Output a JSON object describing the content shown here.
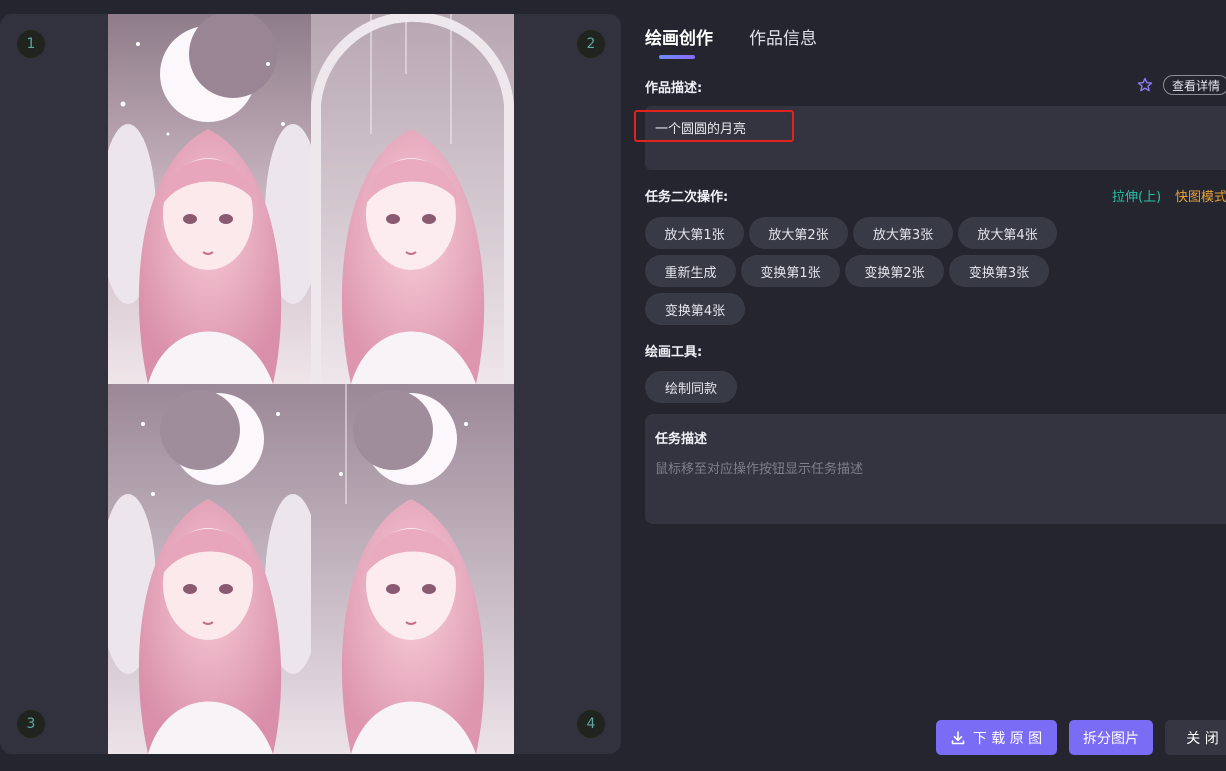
{
  "preview": {
    "quadrant_numbers": [
      "1",
      "2",
      "3",
      "4"
    ]
  },
  "tabs": [
    {
      "label": "绘画创作",
      "active": true
    },
    {
      "label": "作品信息",
      "active": false
    }
  ],
  "description": {
    "label": "作品描述:",
    "value": "一个圆圆的月亮",
    "detail_button": "查看详情",
    "star_icon": "star-outline-icon"
  },
  "secondary_ops": {
    "label": "任务二次操作:",
    "stretch_link": "拉伸(上)",
    "fast_mode_link": "快图模式",
    "buttons": [
      "放大第1张",
      "放大第2张",
      "放大第3张",
      "放大第4张",
      "重新生成",
      "变换第1张",
      "变换第2张",
      "变换第3张",
      "变换第4张"
    ]
  },
  "tools": {
    "label": "绘画工具:",
    "buttons": [
      "绘制同款"
    ]
  },
  "task": {
    "title": "任务描述",
    "hint": "鼠标移至对应操作按钮显示任务描述"
  },
  "footer": {
    "download_label": "下 载 原 图",
    "download_icon": "download-icon",
    "split_label": "拆分图片",
    "close_label": "关 闭"
  },
  "colors": {
    "accent": "#7b6cf6",
    "stretch": "#27c2a5",
    "fast_mode": "#e8a23a",
    "highlight": "#e0231f"
  }
}
